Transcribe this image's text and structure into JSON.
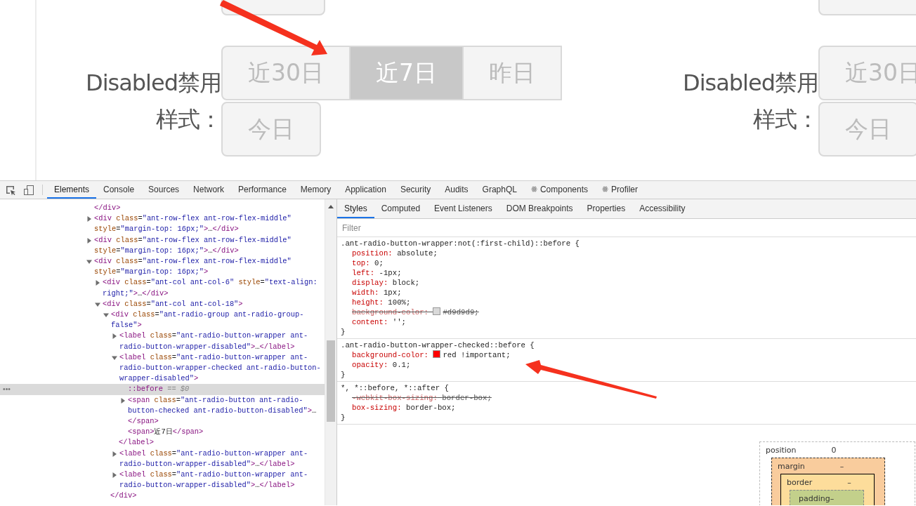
{
  "preview": {
    "groups": [
      {
        "label": "Disabled禁用样式：",
        "cut_button": {
          "selected": false,
          "disabled": true
        },
        "rows": [
          [
            {
              "label": "近30日",
              "selected": false,
              "disabled": true
            },
            {
              "label": "近7日",
              "selected": true,
              "disabled": true
            },
            {
              "label": "昨日",
              "selected": false,
              "disabled": true
            }
          ],
          [
            {
              "label": "今日",
              "selected": false,
              "disabled": true
            }
          ]
        ]
      },
      {
        "label": "Disabled禁用样式：",
        "cut_button": {
          "selected": false,
          "disabled": true
        },
        "rows": [
          [
            {
              "label": "近30日",
              "selected": false,
              "disabled": true
            }
          ],
          [
            {
              "label": "今日",
              "selected": false,
              "disabled": true
            }
          ]
        ]
      }
    ]
  },
  "devtools": {
    "tabs": [
      {
        "label": "Elements",
        "selected": true
      },
      {
        "label": "Console",
        "selected": false
      },
      {
        "label": "Sources",
        "selected": false
      },
      {
        "label": "Network",
        "selected": false
      },
      {
        "label": "Performance",
        "selected": false
      },
      {
        "label": "Memory",
        "selected": false
      },
      {
        "label": "Application",
        "selected": false
      },
      {
        "label": "Security",
        "selected": false
      },
      {
        "label": "Audits",
        "selected": false
      },
      {
        "label": "GraphQL",
        "selected": false
      },
      {
        "label": "Components",
        "selected": false,
        "kind": "react"
      },
      {
        "label": "Profiler",
        "selected": false,
        "kind": "react"
      }
    ],
    "elements": [
      {
        "kind": "leaf",
        "markup": "</div>"
      },
      {
        "kind": "element",
        "markup": "<div class=\"ant-row-flex ant-row-flex-middle\" style=\"margin-top: 16px;\">…</div>",
        "expanded": false
      },
      {
        "kind": "element",
        "markup": "<div class=\"ant-row-flex ant-row-flex-middle\" style=\"margin-top: 16px;\">…</div>",
        "expanded": false
      },
      {
        "kind": "element",
        "markup": "<div class=\"ant-row-flex ant-row-flex-middle\" style=\"margin-top: 16px;\">",
        "expanded": true,
        "children": [
          {
            "kind": "element",
            "markup": "<div class=\"ant-col ant-col-6\" style=\"text-align: right;\">…</div>",
            "expanded": false
          },
          {
            "kind": "element",
            "markup": "<div class=\"ant-col ant-col-18\">",
            "expanded": true,
            "children": [
              {
                "kind": "element",
                "markup": "<div class=\"ant-radio-group ant-radio-group-false\">",
                "expanded": true,
                "closing": "</div>",
                "children": [
                  {
                    "kind": "element",
                    "markup": "<label class=\"ant-radio-button-wrapper ant-radio-button-wrapper-disabled\">…</label>",
                    "expanded": false
                  },
                  {
                    "kind": "element",
                    "markup": "<label class=\"ant-radio-button-wrapper ant-radio-button-wrapper-checked ant-radio-button-wrapper-disabled\">",
                    "expanded": true,
                    "closing": "</label>",
                    "children": [
                      {
                        "kind": "pseudo",
                        "markup": "::before",
                        "ref": "== $0",
                        "marker": "•••",
                        "selected": true
                      },
                      {
                        "kind": "element",
                        "markup": "<span class=\"ant-radio-button ant-radio-button-checked ant-radio-button-disabled\">…</span>",
                        "expanded": false
                      },
                      {
                        "kind": "leaf",
                        "markup": "<span>近7日</span>"
                      }
                    ]
                  },
                  {
                    "kind": "element",
                    "markup": "<label class=\"ant-radio-button-wrapper ant-radio-button-wrapper-disabled\">…</label>",
                    "expanded": false
                  },
                  {
                    "kind": "element",
                    "markup": "<label class=\"ant-radio-button-wrapper ant-radio-button-wrapper-disabled\">…</label>",
                    "expanded": false
                  }
                ]
              }
            ]
          }
        ]
      }
    ],
    "side_tabs": [
      {
        "label": "Styles",
        "selected": true
      },
      {
        "label": "Computed",
        "selected": false
      },
      {
        "label": "Event Listeners",
        "selected": false
      },
      {
        "label": "DOM Breakpoints",
        "selected": false
      },
      {
        "label": "Properties",
        "selected": false
      },
      {
        "label": "Accessibility",
        "selected": false
      }
    ],
    "filter": {
      "placeholder": "Filter"
    },
    "rules": [
      {
        "selector": ".ant-radio-button-wrapper:not(:first-child)::before {",
        "close": "}",
        "declarations": [
          {
            "text": "position: absolute;",
            "overridden": false
          },
          {
            "text": "top: 0;",
            "overridden": false
          },
          {
            "text": "left: -1px;",
            "overridden": false
          },
          {
            "text": "display: block;",
            "overridden": false
          },
          {
            "text": "width: 1px;",
            "overridden": false
          },
          {
            "text": "height: 100%;",
            "overridden": false
          },
          {
            "text": "background-color: #d9d9d9;",
            "overridden": true,
            "color": "#d9d9d9"
          },
          {
            "text": "content: '';",
            "overridden": false
          }
        ]
      },
      {
        "selector": ".ant-radio-button-wrapper-checked::before {",
        "close": "}",
        "declarations": [
          {
            "text": "background-color: red !important;",
            "overridden": false,
            "color": "#ff0000"
          },
          {
            "text": "opacity: 0.1;",
            "overridden": false
          }
        ]
      },
      {
        "selector": "*, *::before, *::after {",
        "close": "}",
        "declarations": [
          {
            "text": "-webkit-box-sizing: border-box;",
            "overridden": true
          },
          {
            "text": "box-sizing: border-box;",
            "overridden": false
          }
        ]
      }
    ],
    "box_model": {
      "position": {
        "label": "position",
        "value": "0"
      },
      "margin": {
        "label": "margin",
        "value": "–"
      },
      "border": {
        "label": "border",
        "value": "–"
      },
      "padding": {
        "label": "padding",
        "value": "–"
      }
    }
  }
}
